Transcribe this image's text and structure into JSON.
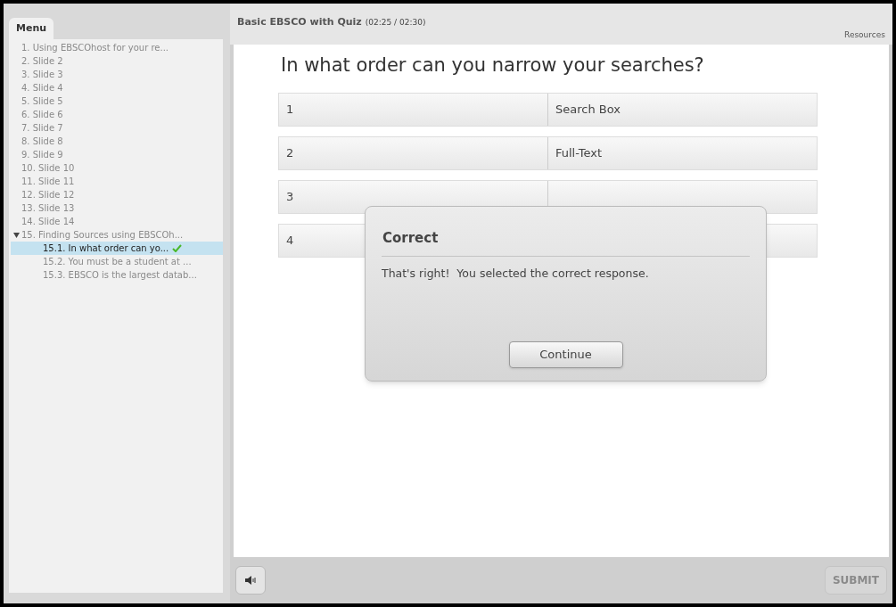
{
  "sidebar": {
    "tab": "Menu",
    "items": [
      {
        "label": "1. Using EBSCOhost  for your re...",
        "selected": false,
        "completed": false
      },
      {
        "label": "2. Slide 2",
        "selected": false,
        "completed": false
      },
      {
        "label": "3. Slide 3",
        "selected": false,
        "completed": false
      },
      {
        "label": "4. Slide 4",
        "selected": false,
        "completed": false
      },
      {
        "label": "5. Slide 5",
        "selected": false,
        "completed": false
      },
      {
        "label": "6. Slide 6",
        "selected": false,
        "completed": false
      },
      {
        "label": "7. Slide 7",
        "selected": false,
        "completed": false
      },
      {
        "label": "8. Slide 8",
        "selected": false,
        "completed": false
      },
      {
        "label": "9. Slide 9",
        "selected": false,
        "completed": false
      },
      {
        "label": "10. Slide 10",
        "selected": false,
        "completed": false
      },
      {
        "label": "11. Slide 11",
        "selected": false,
        "completed": false
      },
      {
        "label": "12. Slide 12",
        "selected": false,
        "completed": false
      },
      {
        "label": "13. Slide 13",
        "selected": false,
        "completed": false
      },
      {
        "label": "14. Slide 14",
        "selected": false,
        "completed": false
      },
      {
        "label": "15. Finding Sources using EBSCOh...",
        "selected": false,
        "completed": false,
        "expanded": true,
        "children": [
          {
            "label": "15.1. In what order can yo...",
            "selected": true,
            "completed": true
          },
          {
            "label": "15.2. You must be a student at ...",
            "selected": false,
            "completed": false
          },
          {
            "label": "15.3. EBSCO is the largest datab...",
            "selected": false,
            "completed": false
          }
        ]
      }
    ]
  },
  "header": {
    "title": "Basic EBSCO with Quiz",
    "time": "(02:25 / 02:30)",
    "resources": "Resources"
  },
  "question": "In what order can you narrow your searches?",
  "matches": [
    {
      "number": "1",
      "answer": "Search Box"
    },
    {
      "number": "2",
      "answer": "Full-Text"
    },
    {
      "number": "3"
    },
    {
      "number": "4"
    }
  ],
  "dialog": {
    "title": "Correct",
    "message": "That's right!  You selected the correct response.",
    "button": "Continue"
  },
  "footer": {
    "submit": {
      "label": "SUBMIT",
      "disabled": true
    }
  }
}
